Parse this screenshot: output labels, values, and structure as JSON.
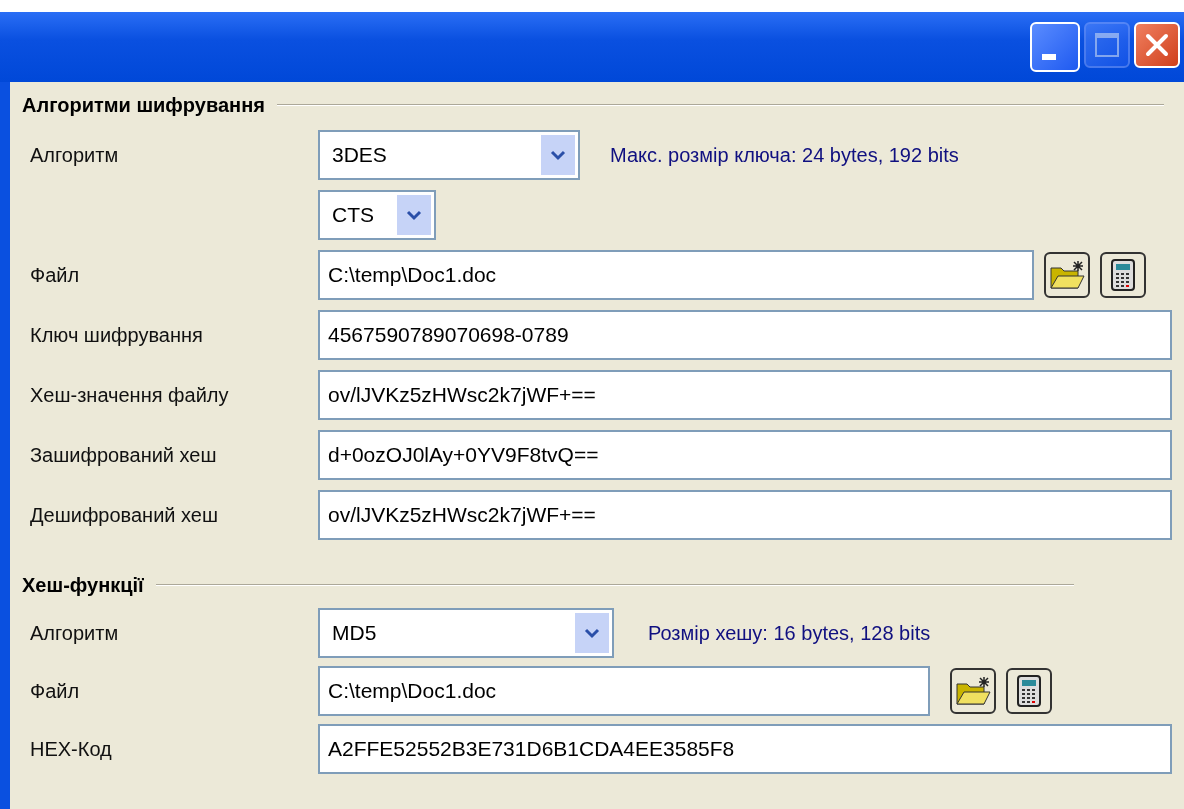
{
  "window": {
    "controls": [
      {
        "kind": "minimize",
        "disabled": false
      },
      {
        "kind": "maximize",
        "disabled": true
      },
      {
        "kind": "close",
        "disabled": false
      }
    ]
  },
  "sections": [
    {
      "title": "Алгоритми шифрування",
      "rows": [
        {
          "kind": "combo",
          "label": "Алгоритм",
          "value": "3DES",
          "info": "Макс. розмір ключа: 24 bytes, 192 bits"
        },
        {
          "kind": "combo",
          "value": "CTS"
        },
        {
          "kind": "file",
          "label": "Файл",
          "value": "C:\\temp\\Doc1.doc"
        },
        {
          "kind": "field",
          "label": "Ключ шифрування",
          "value": "4567590789070698-0789"
        },
        {
          "kind": "field",
          "label": "Хеш-значення файлу",
          "value": "ov/lJVKz5zHWsc2k7jWF+=="
        },
        {
          "kind": "field",
          "label": "Зашифрований хеш",
          "value": "d+0ozOJ0lAy+0YV9F8tvQ=="
        },
        {
          "kind": "field",
          "label": "Дешифрований хеш",
          "value": "ov/lJVKz5zHWsc2k7jWF+=="
        }
      ]
    },
    {
      "title": "Хеш-функції",
      "rows": [
        {
          "kind": "combo",
          "label": "Алгоритм",
          "value": "MD5",
          "info": "Розмір хешу: 16 bytes, 128 bits"
        },
        {
          "kind": "file",
          "label": "Файл",
          "value": "C:\\temp\\Doc1.doc"
        },
        {
          "kind": "field",
          "label": "HEX-Код",
          "value": "A2FFE52552B3E731D6B1CDA4EE3585F8"
        }
      ]
    }
  ]
}
